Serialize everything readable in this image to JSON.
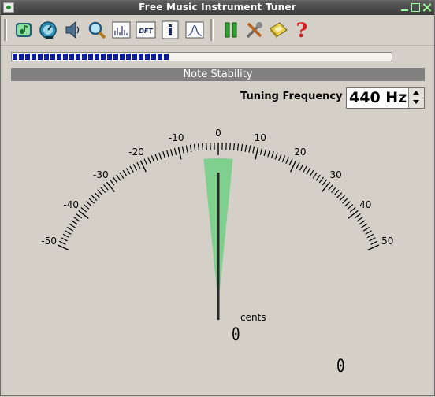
{
  "window": {
    "title": "Free Music Instrument Tuner"
  },
  "toolbar": {
    "icons": [
      "capture-icon",
      "metronome-icon",
      "speaker-icon",
      "zoom-icon",
      "spectrum-icon",
      "dft-icon",
      "info-icon",
      "waveform-icon",
      "pause-icon",
      "settings-icon",
      "save-icon",
      "help-icon"
    ],
    "dft_label": "DFT"
  },
  "progress": {
    "value": 0.41
  },
  "stability_label": "Note Stability",
  "tuning": {
    "label": "Tuning Frequency",
    "value": "440 Hz"
  },
  "meter": {
    "scale_min": -50,
    "scale_max": 50,
    "labels": [
      "-50",
      "-40",
      "-30",
      "-20",
      "-10",
      "0",
      "10",
      "20",
      "30",
      "40",
      "50"
    ],
    "needle_cents": 0,
    "accept_band_cents": [
      -4,
      4
    ],
    "band_color": "#7fcf8f",
    "unit_label": "cents"
  },
  "readouts": {
    "cents_value": "0",
    "secondary_value": "0"
  }
}
